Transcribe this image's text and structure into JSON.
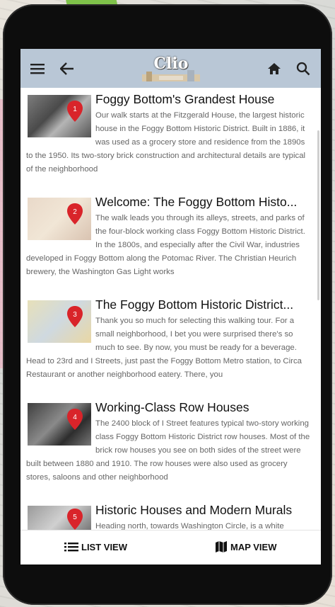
{
  "app": {
    "logo_text": "Clio"
  },
  "items": [
    {
      "title": "Foggy Bottom's Grandest House",
      "description": "Our walk starts at the Fitzgerald House, the largest historic house in the Foggy Bottom Historic District. Built in 1886, it was used as a grocery store and residence from the 1890s to the 1950. Its two-story brick construction and architectural details are typical of the neighborhood",
      "pin_number": "1"
    },
    {
      "title": "Welcome: The Foggy Bottom Histo...",
      "description": "The walk leads you through its alleys, streets, and parks of the four-block working class Foggy Bottom Historic District. In the 1800s, and especially after the Civil War, industries developed in Foggy Bottom along the Potomac River. The Christian Heurich brewery, the Washington Gas Light works",
      "pin_number": "2"
    },
    {
      "title": "The Foggy Bottom Historic District...",
      "description": "Thank you so much for selecting this walking tour. For a small neighborhood, I bet you were surprised there's so much to see. By now, you must be ready for a beverage. Head to 23rd and I Streets, just past the Foggy Bottom Metro station, to Circa Restaurant or another neighborhood eatery. There, you",
      "pin_number": "3"
    },
    {
      "title": "Working-Class Row Houses",
      "description": "The 2400 block of I Street features typical two-story working class Foggy Bottom Historic District row houses. Most of the brick row houses you see on both sides of the street were built between 1880 and 1910. The row houses were also used as grocery stores, saloons and other neighborhood",
      "pin_number": "4"
    },
    {
      "title": "Historic Houses and Modern Murals",
      "description": "Heading north, towards Washington Circle, is a white",
      "pin_number": "5"
    }
  ],
  "tabs": {
    "list_label": "LIST VIEW",
    "map_label": "MAP VIEW"
  },
  "colors": {
    "appbar": "#b9c7d6",
    "pin": "#d9242a"
  }
}
